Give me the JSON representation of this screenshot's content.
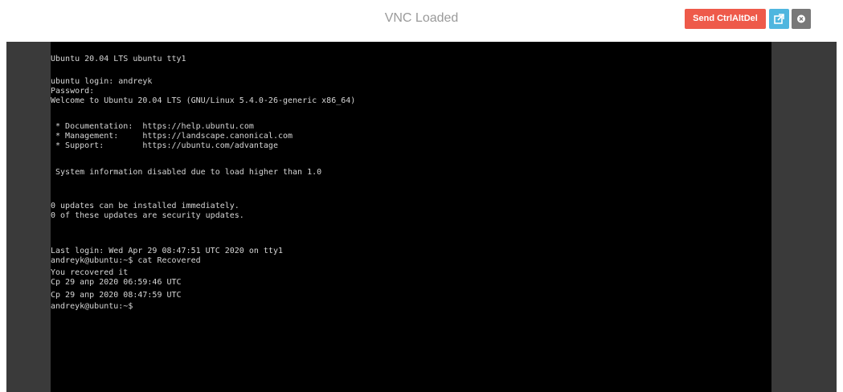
{
  "header": {
    "status_text": "VNC Loaded",
    "send_ctrlaltdel_label": "Send CtrlAltDel",
    "popout_icon": "external-link-icon",
    "close_icon": "close-circle-icon",
    "colors": {
      "ctrlaltdel": "#ee5a4a",
      "popout": "#4fb6df",
      "close": "#787878"
    }
  },
  "console": {
    "lines": [
      "Ubuntu 20.04 LTS ubuntu tty1",
      "",
      "ubuntu login: andreyk",
      "Password:",
      "Welcome to Ubuntu 20.04 LTS (GNU/Linux 5.4.0-26-generic x86_64)",
      "",
      " * Documentation:  https://help.ubuntu.com",
      " * Management:     https://landscape.canonical.com",
      " * Support:        https://ubuntu.com/advantage",
      "",
      " System information disabled due to load higher than 1.0",
      "",
      "",
      "0 updates can be installed immediately.",
      "0 of these updates are security updates.",
      "",
      "",
      "Last login: Wed Apr 29 08:47:51 UTC 2020 on tty1",
      "andreyk@ubuntu:~$ cat Recovered",
      "You recovered it",
      "Ср 29 апр 2020 06:59:46 UTC",
      "Ср 29 апр 2020 08:47:59 UTC",
      "andreyk@ubuntu:~$"
    ]
  }
}
